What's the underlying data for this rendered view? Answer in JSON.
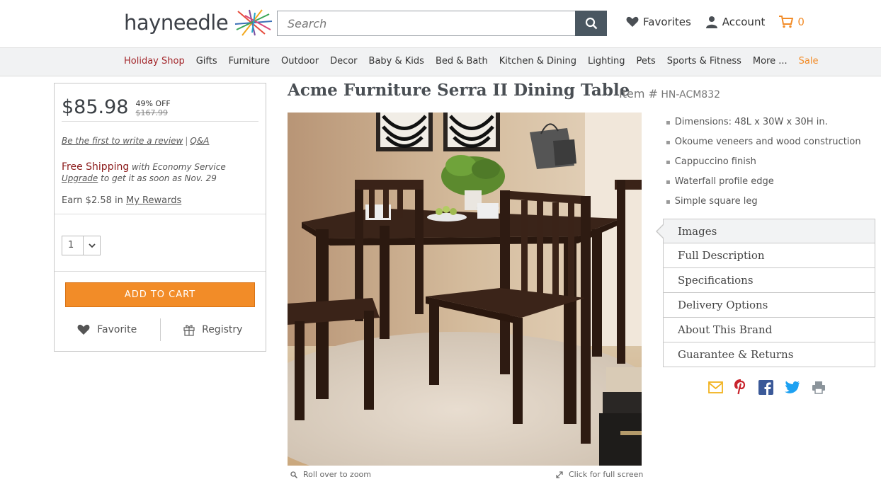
{
  "header": {
    "logo_text": "hayneedle",
    "search_placeholder": "Search",
    "favorites_label": "Favorites",
    "account_label": "Account",
    "cart_count": "0"
  },
  "nav": {
    "items": [
      "Holiday Shop",
      "Gifts",
      "Furniture",
      "Outdoor",
      "Decor",
      "Baby & Kids",
      "Bed & Bath",
      "Kitchen & Dining",
      "Lighting",
      "Pets",
      "Sports & Fitness",
      "More ...",
      "Sale"
    ]
  },
  "product": {
    "title": "Acme Furniture Serra II Dining Table",
    "item_label": "Item #",
    "item_number": "HN-ACM832",
    "price": "$85.98",
    "discount": "49% OFF",
    "original_price": "$167.99",
    "review_link": "Be the first to write a review",
    "qa_link": "Q&A",
    "free_shipping": "Free Shipping",
    "shipping_service": " with Economy Service",
    "upgrade_link": "Upgrade",
    "upgrade_text": " to get it as soon as Nov. 29",
    "earn_text": "Earn $2.58 in ",
    "rewards_link": "My Rewards",
    "quantity": "1",
    "add_to_cart": "ADD TO CART",
    "favorite_label": "Favorite",
    "registry_label": "Registry",
    "zoom_caption": "Roll over to zoom",
    "fullscreen_caption": "Click for full screen",
    "features": [
      "Dimensions: 48L x 30W x 30H in.",
      "Okoume veneers and wood construction",
      "Cappuccino finish",
      "Waterfall profile edge",
      "Simple square leg"
    ],
    "tabs": [
      "Images",
      "Full Description",
      "Specifications",
      "Delivery Options",
      "About This Brand",
      "Guarantee & Returns"
    ]
  },
  "colors": {
    "accent_orange": "#f28c28",
    "holiday_red": "#a3262a",
    "search_button": "#4a5761"
  },
  "share_icons": [
    "email-icon",
    "pinterest-icon",
    "facebook-icon",
    "twitter-icon",
    "print-icon"
  ]
}
